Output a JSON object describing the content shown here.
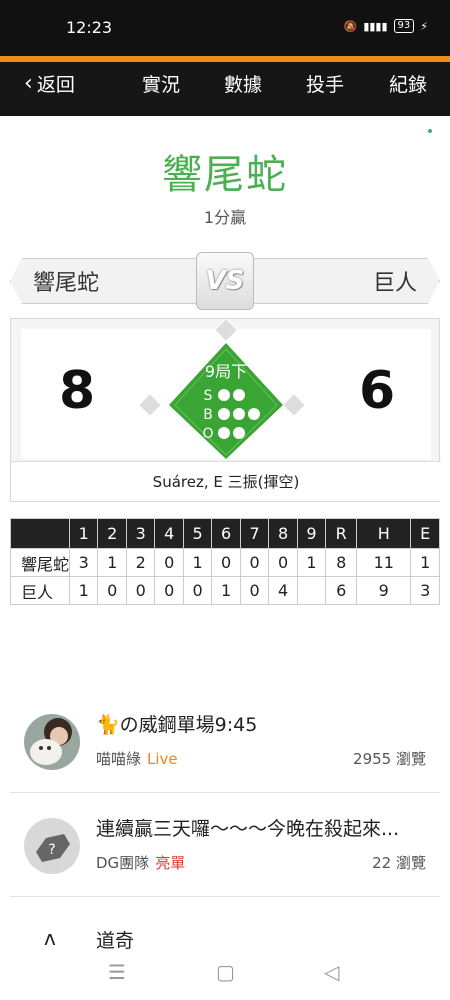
{
  "status": {
    "time": "12:23",
    "battery": "93"
  },
  "nav": {
    "back_label": "返回",
    "tabs": [
      {
        "label": "實況",
        "active": true
      },
      {
        "label": "數據",
        "active": false
      },
      {
        "label": "投手",
        "active": false
      },
      {
        "label": "紀錄",
        "active": false
      }
    ],
    "accent": "#f08a1a"
  },
  "game": {
    "winner": "響尾蛇",
    "result": "1分贏",
    "winner_color": "#4caf50",
    "away_team": "響尾蛇",
    "home_team": "巨人",
    "vs_label": "VS",
    "away_score": "8",
    "home_score": "6",
    "inning": "9局下",
    "count": {
      "S": "S",
      "B": "B",
      "O": "O"
    },
    "last_play": "Suárez, E 三振(揮空)"
  },
  "linescore": {
    "headers": [
      "1",
      "2",
      "3",
      "4",
      "5",
      "6",
      "7",
      "8",
      "9",
      "R",
      "H",
      "E"
    ],
    "rows": [
      {
        "team": "響尾蛇",
        "cells": [
          "3",
          "1",
          "2",
          "0",
          "1",
          "0",
          "0",
          "0",
          "1",
          "8",
          "11",
          "1"
        ]
      },
      {
        "team": "巨人",
        "cells": [
          "1",
          "0",
          "0",
          "0",
          "0",
          "1",
          "0",
          "4",
          "",
          "6",
          "9",
          "3"
        ]
      }
    ]
  },
  "feed": [
    {
      "title": "🐈の威鋼單場9:45",
      "author": "喵喵綠",
      "tag": "Live",
      "tag_color": "#f08a1a",
      "views": "2955 瀏覽"
    },
    {
      "title": "連續贏三天囉～～～今晚在殺起來...",
      "author": "DG團隊",
      "tag": "亮單",
      "tag_color": "#e53935",
      "views": "22 瀏覽"
    },
    {
      "title": "道奇"
    }
  ],
  "icons": {
    "back": "chevron-left-icon",
    "menu": "menu-icon",
    "home": "home-icon",
    "back_nav": "triangle-back-icon"
  }
}
